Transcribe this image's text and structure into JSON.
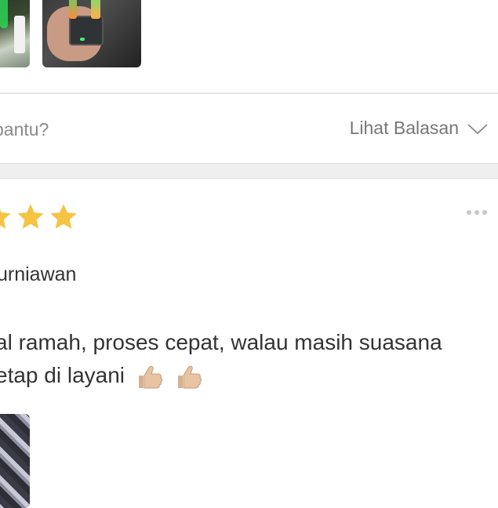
{
  "previous_review": {
    "help_prompt": "bantu?",
    "reply_toggle_label": "Lihat Balasan"
  },
  "review": {
    "rating_stars_visible": 3,
    "reviewer_name": "urniawan",
    "text_line1": "al ramah, proses cepat, walau masih suasana",
    "text_line2": "etap di layani"
  },
  "colors": {
    "star": "#F6C443",
    "divider": "#E5E5E5",
    "gap_bar": "#EFEFEF",
    "muted_text": "#8A8A8A"
  },
  "icons": [
    "chevron-down-icon",
    "more-options-icon",
    "star-icon",
    "thumbs-up-icon"
  ]
}
